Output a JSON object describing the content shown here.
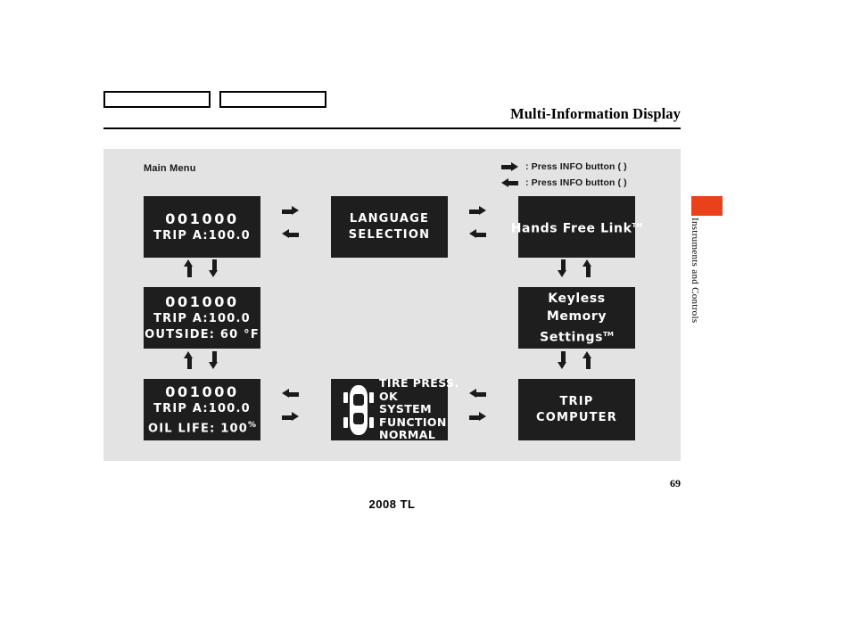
{
  "header": {
    "title": "Multi-Information Display",
    "box_1_label": "",
    "box_2_label": ""
  },
  "side_tab": {
    "label": "Instruments and Controls",
    "color": "#E8411C"
  },
  "diagram": {
    "caption": "Main Menu",
    "background_color": "#E3E3E3",
    "screen_color": "#1E1E1E",
    "legend": [
      {
        "icon": "arrow-right-icon",
        "text": ": Press INFO button (   )"
      },
      {
        "icon": "arrow-left-icon",
        "text": ": Press INFO button (   )"
      }
    ],
    "screens": {
      "odometer_trip": {
        "odometer": "001000",
        "line_2": "TRIP A:100.0"
      },
      "language_selection": {
        "line_1": "LANGUAGE",
        "line_2": "SELECTION"
      },
      "hands_free_link": {
        "line_1": "Hands Free Link",
        "trademark": "TM"
      },
      "odometer_outside_temp": {
        "odometer": "001000",
        "line_2": "TRIP A:100.0",
        "line_3": "OUTSIDE:  60 °F"
      },
      "keyless_memory": {
        "line_1": "Keyless",
        "line_2": "Memory",
        "line_3": "Settings",
        "trademark": "TM"
      },
      "odometer_oil_life": {
        "odometer": "001000",
        "line_2": "TRIP A:100.0",
        "line_3": "OIL LIFE:  100",
        "unit": "%"
      },
      "tire_pressure": {
        "icon": "car-top-view-icon",
        "line_1": "TIRE PRESS.",
        "line_2": "OK",
        "line_3": "SYSTEM",
        "line_4": "FUNCTION",
        "line_5": "NORMAL"
      },
      "trip_computer": {
        "line_1": "TRIP",
        "line_2": "COMPUTER"
      }
    }
  },
  "footer": {
    "page_number": "69",
    "model": "2008  TL"
  }
}
